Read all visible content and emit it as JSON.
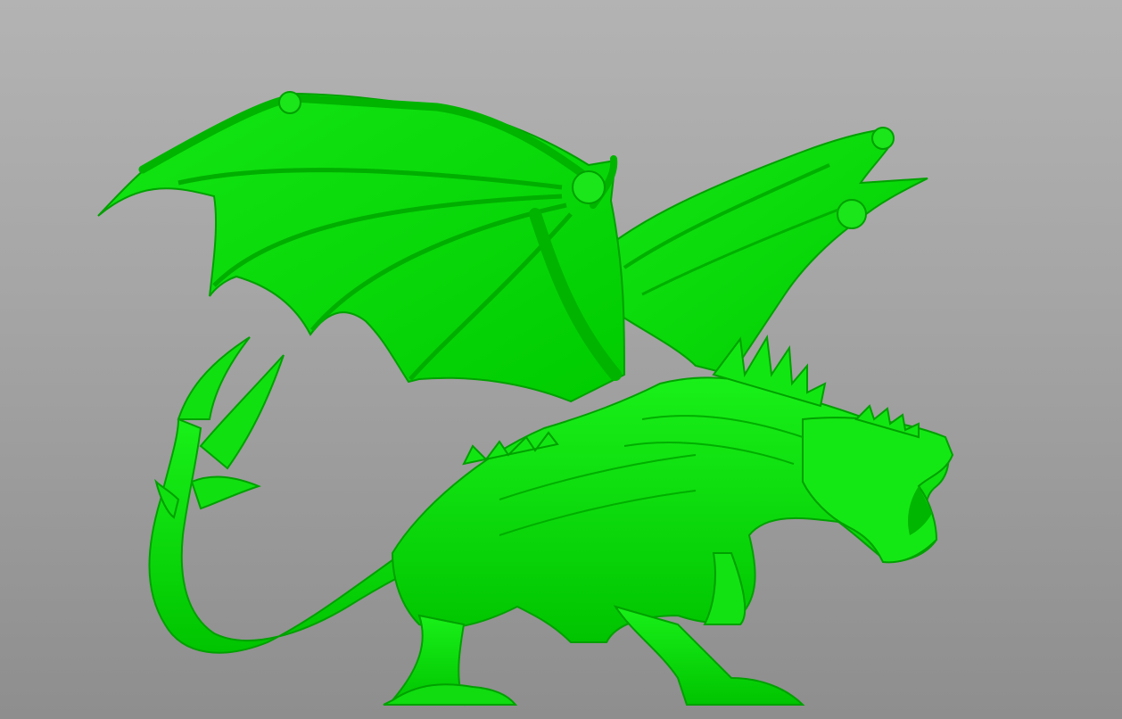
{
  "viewport": {
    "background_top": "#b3b3b3",
    "background_bottom": "#8e8e8e"
  },
  "model": {
    "subject": "dragon-figure",
    "color": "#00e000",
    "shadow_color": "#00a800",
    "highlight_color": "#5cff5c"
  }
}
